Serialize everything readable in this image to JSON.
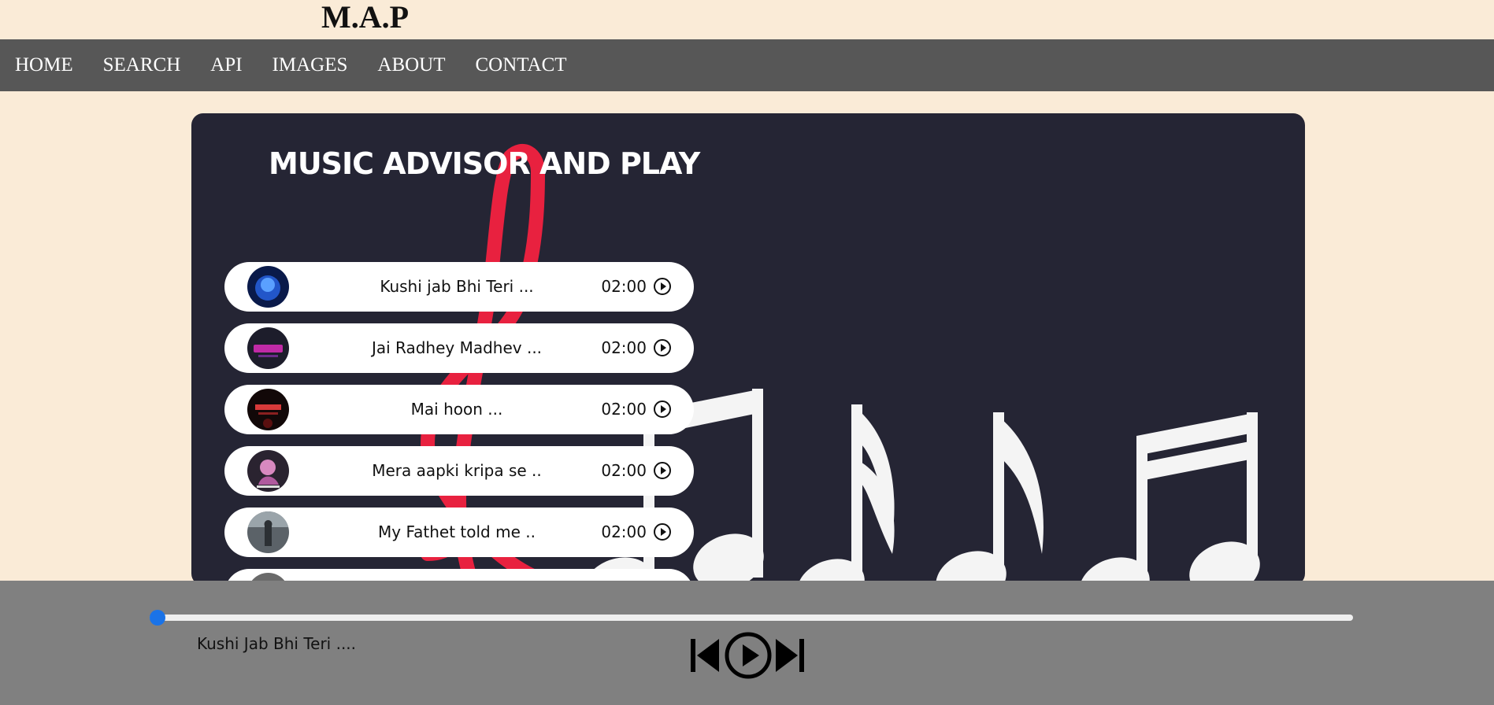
{
  "brand": {
    "logo": "M.A.P"
  },
  "nav": {
    "items": [
      {
        "label": "HOME"
      },
      {
        "label": "SEARCH"
      },
      {
        "label": "API"
      },
      {
        "label": "IMAGES"
      },
      {
        "label": "ABOUT"
      },
      {
        "label": "CONTACT"
      }
    ]
  },
  "main": {
    "title": "MUSIC ADVISOR AND PLAY",
    "songs": [
      {
        "title": "Kushi jab Bhi Teri ...",
        "duration": "02:00",
        "thumb": "blue-face-icon"
      },
      {
        "title": "Jai Radhey Madhev ...",
        "duration": "02:00",
        "thumb": "neon-text-icon"
      },
      {
        "title": "Mai hoon ...",
        "duration": "02:00",
        "thumb": "red-title-icon"
      },
      {
        "title": "Mera aapki kripa se ..",
        "duration": "02:00 ",
        "thumb": "pink-figure-icon"
      },
      {
        "title": "My Fathet told me ..",
        "duration": "02:00 ",
        "thumb": "misty-figure-icon"
      }
    ]
  },
  "player": {
    "now_playing": "Kushi Jab Bhi Teri ....",
    "progress": 0.0,
    "accent_color": "#1a73e8"
  },
  "colors": {
    "page_bg": "#faebd7",
    "nav_bg": "#575757",
    "panel_bg": "#252534",
    "player_bg": "#808080"
  }
}
